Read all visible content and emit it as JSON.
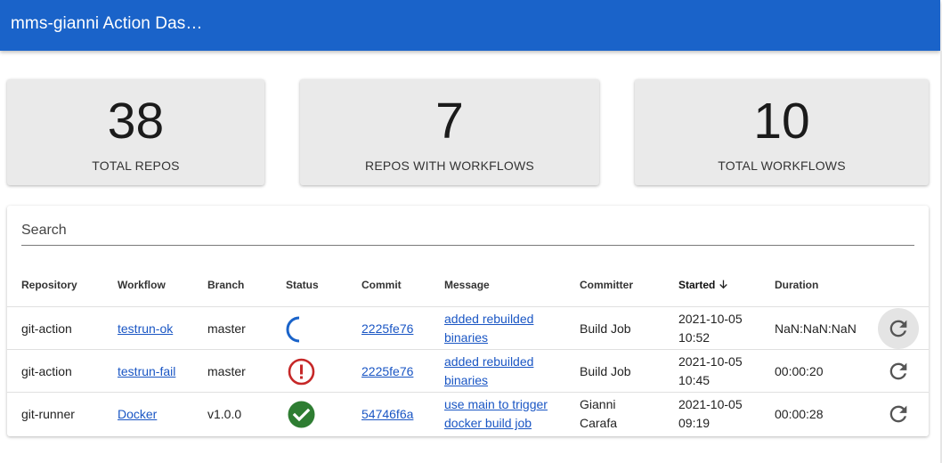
{
  "appbar": {
    "title": "mms-gianni Action Das…"
  },
  "stats": [
    {
      "value": "38",
      "label": "TOTAL REPOS"
    },
    {
      "value": "7",
      "label": "REPOS WITH WORKFLOWS"
    },
    {
      "value": "10",
      "label": "TOTAL WORKFLOWS"
    }
  ],
  "search": {
    "placeholder": "Search"
  },
  "table": {
    "headers": {
      "repository": "Repository",
      "workflow": "Workflow",
      "branch": "Branch",
      "status": "Status",
      "commit": "Commit",
      "message": "Message",
      "committer": "Committer",
      "started": "Started",
      "duration": "Duration"
    },
    "rows": [
      {
        "repository": "git-action",
        "workflow": "testrun-ok",
        "branch": "master",
        "status": "in-progress",
        "commit": "2225fe76",
        "message_line1": "added rebuilded",
        "message_line2": "binaries",
        "committer_line1": "Build Job",
        "committer_line2": "",
        "started_date": "2021-10-05",
        "started_time": "10:52",
        "duration": "NaN:NaN:NaN"
      },
      {
        "repository": "git-action",
        "workflow": "testrun-fail",
        "branch": "master",
        "status": "failure",
        "commit": "2225fe76",
        "message_line1": "added rebuilded",
        "message_line2": "binaries",
        "committer_line1": "Build Job",
        "committer_line2": "",
        "started_date": "2021-10-05",
        "started_time": "10:45",
        "duration": "00:00:20"
      },
      {
        "repository": "git-runner",
        "workflow": "Docker",
        "branch": "v1.0.0",
        "status": "success",
        "commit": "54746f6a",
        "message_line1": "use main to trigger",
        "message_line2": "docker build job",
        "committer_line1": "Gianni",
        "committer_line2": "Carafa",
        "started_date": "2021-10-05",
        "started_time": "09:19",
        "duration": "00:00:28"
      }
    ]
  },
  "colors": {
    "appbar": "#1a63c9",
    "link": "#1a56c4",
    "in_progress": "#1a63c9",
    "failure": "#c62828",
    "success": "#2e7d32"
  },
  "icons": {
    "sort": "arrow-down-icon",
    "rerun": "refresh-icon",
    "in_progress": "spinner-icon",
    "failure": "error-icon",
    "success": "check-circle-icon"
  }
}
